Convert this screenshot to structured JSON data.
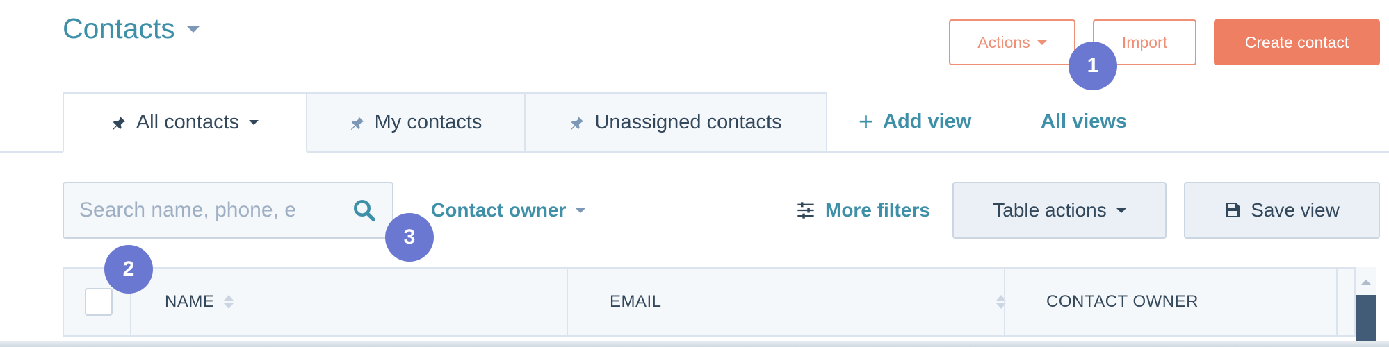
{
  "header": {
    "title": "Contacts",
    "actions_label": "Actions",
    "import_label": "Import",
    "create_label": "Create contact"
  },
  "tabs": [
    {
      "label": "All contacts",
      "active": true
    },
    {
      "label": "My contacts",
      "active": false
    },
    {
      "label": "Unassigned contacts",
      "active": false
    }
  ],
  "views": {
    "add_view_label": "Add view",
    "all_views_label": "All views"
  },
  "filters": {
    "search_placeholder": "Search name, phone, e",
    "contact_owner_label": "Contact owner",
    "more_filters_label": "More filters",
    "table_actions_label": "Table actions",
    "save_view_label": "Save view"
  },
  "table": {
    "columns": [
      "NAME",
      "EMAIL",
      "CONTACT OWNER"
    ]
  },
  "badges": [
    "1",
    "2",
    "3"
  ],
  "colors": {
    "accent": "#3e8fa8",
    "primary_button": "#ee7f62",
    "badge": "#6a78d1"
  },
  "icons": [
    "caret-down-icon",
    "pin-icon",
    "plus-icon",
    "search-icon",
    "filter-sliders-icon",
    "save-icon",
    "sort-icon"
  ]
}
